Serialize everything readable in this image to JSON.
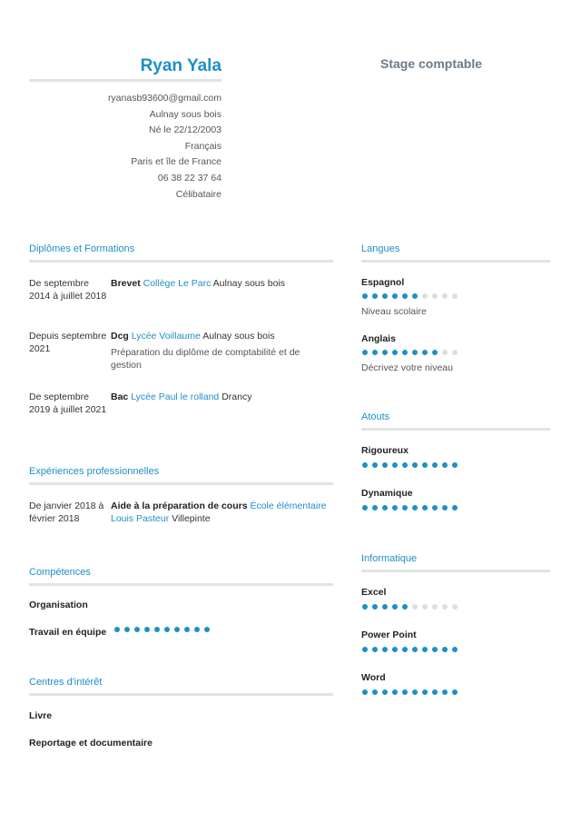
{
  "header": {
    "name": "Ryan Yala",
    "job_title": "Stage comptable",
    "contact": [
      "ryanasb93600@gmail.com",
      "Aulnay sous bois",
      "Né le 22/12/2003",
      "Français",
      "Paris et île de France",
      "06 38 22 37 64",
      "Célibataire"
    ]
  },
  "education": {
    "title": "Diplômes et Formations",
    "items": [
      {
        "date": "De septembre 2014 à juillet 2018",
        "degree": "Brevet",
        "school": "Collège Le Parc",
        "city": "Aulnay sous bois",
        "description": ""
      },
      {
        "date": "Depuis septembre 2021",
        "degree": "Dcg",
        "school": "Lycée Voillaume",
        "city": "Aulnay sous bois",
        "description": "Préparation du diplôme de comptabilité et de gestion"
      },
      {
        "date": "De septembre 2019 à juillet 2021",
        "degree": "Bac",
        "school": "Lycée Paul le rolland",
        "city": "Drancy",
        "description": ""
      }
    ]
  },
  "experience": {
    "title": "Expériences professionnelles",
    "items": [
      {
        "date": "De janvier 2018 à février 2018",
        "role": "Aide à la préparation de cours",
        "employer": "École élémentaire Louis Pasteur",
        "city": "Villepinte"
      }
    ]
  },
  "skills": {
    "title": "Compétences",
    "items": [
      {
        "label": "Organisation"
      },
      {
        "label": "Travail en équipe",
        "level": 10,
        "max": 10
      }
    ]
  },
  "interests": {
    "title": "Centres d'intérêt",
    "items": [
      "Livre",
      "Reportage et documentaire"
    ]
  },
  "languages": {
    "title": "Langues",
    "items": [
      {
        "label": "Espagnol",
        "level": 6,
        "max": 10,
        "note": "Niveau scolaire"
      },
      {
        "label": "Anglais",
        "level": 8,
        "max": 10,
        "note": "Décrivez votre niveau"
      }
    ]
  },
  "strengths": {
    "title": "Atouts",
    "items": [
      {
        "label": "Rigoureux",
        "level": 10,
        "max": 10
      },
      {
        "label": "Dynamique",
        "level": 10,
        "max": 10
      }
    ]
  },
  "computing": {
    "title": "Informatique",
    "items": [
      {
        "label": "Excel",
        "level": 5,
        "max": 10
      },
      {
        "label": "Power Point",
        "level": 10,
        "max": 10
      },
      {
        "label": "Word",
        "level": 10,
        "max": 10
      }
    ]
  },
  "colors": {
    "accent": "#1e8fc6",
    "rule": "#e3e3e3",
    "dot_off": "#dedede"
  }
}
